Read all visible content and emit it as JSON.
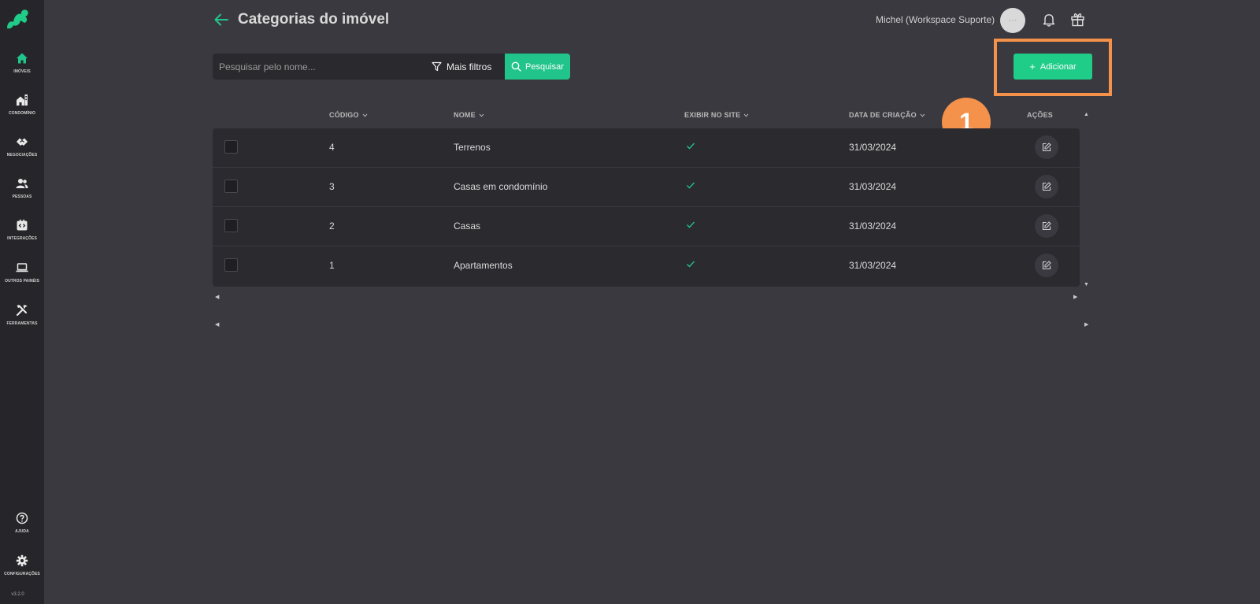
{
  "sidebar": {
    "items": [
      {
        "label": "IMÓVEIS",
        "icon": "home-icon",
        "active": true
      },
      {
        "label": "CONDOMÍNIO",
        "icon": "building-icon"
      },
      {
        "label": "NEGOCIAÇÕES",
        "icon": "handshake-icon"
      },
      {
        "label": "PESSOAS",
        "icon": "people-icon"
      },
      {
        "label": "INTEGRAÇÕES",
        "icon": "integration-icon"
      },
      {
        "label": "OUTROS PAINÉIS",
        "icon": "laptop-icon"
      },
      {
        "label": "FERRAMENTAS",
        "icon": "tools-icon"
      }
    ],
    "bottom": [
      {
        "label": "AJUDA",
        "icon": "help-icon"
      },
      {
        "label": "CONFIGURAÇÕES",
        "icon": "gear-icon"
      }
    ],
    "version": "v3.2.0"
  },
  "header": {
    "title": "Categorias do imóvel",
    "user": "Michel (Workspace Suporte)",
    "avatar_text": "···"
  },
  "search": {
    "placeholder": "Pesquisar pelo nome...",
    "value": "",
    "filters_label": "Mais filtros",
    "search_label": "Pesquisar"
  },
  "actions": {
    "add_label": "Adicionar"
  },
  "annotation": {
    "step": "1"
  },
  "table": {
    "columns": {
      "code": "CÓDIGO",
      "name": "NOME",
      "show_on_site": "EXIBIR NO SITE",
      "created": "DATA DE CRIAÇÃO",
      "actions": "AÇÕES"
    },
    "rows": [
      {
        "code": "4",
        "name": "Terrenos",
        "show_on_site": true,
        "created": "31/03/2024"
      },
      {
        "code": "3",
        "name": "Casas em condomínio",
        "show_on_site": true,
        "created": "31/03/2024"
      },
      {
        "code": "2",
        "name": "Casas",
        "show_on_site": true,
        "created": "31/03/2024"
      },
      {
        "code": "1",
        "name": "Apartamentos",
        "show_on_site": true,
        "created": "31/03/2024"
      }
    ]
  },
  "colors": {
    "accent": "#21c48a",
    "highlight": "#f4914a",
    "background": "#3a393f",
    "sidebar": "#26262a"
  }
}
